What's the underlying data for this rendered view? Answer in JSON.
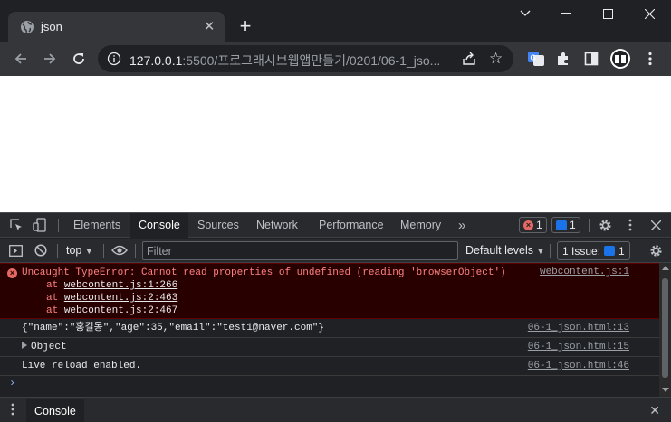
{
  "browser": {
    "tab_title": "json",
    "new_tab": "+",
    "url_host": "127.0.0.1",
    "url_rest": ":5500/프로그래시브웹앱만들기/0201/06-1_jso..."
  },
  "devtools": {
    "tabs": [
      {
        "label": "Elements"
      },
      {
        "label": "Console"
      },
      {
        "label": "Sources"
      },
      {
        "label": "Network"
      },
      {
        "label": "Performance"
      },
      {
        "label": "Memory"
      }
    ],
    "more_tabs": "»",
    "error_count": "1",
    "message_count": "1",
    "context": "top",
    "filter_placeholder": "Filter",
    "levels_label": "Default levels",
    "issues_label": "1 Issue:",
    "issues_count": "1"
  },
  "console": {
    "error": {
      "text": "Uncaught TypeError: Cannot read properties of undefined (reading 'browserObject')",
      "source": "webcontent.js:1",
      "stack": [
        {
          "prefix": "at ",
          "link": "webcontent.js:1:266"
        },
        {
          "prefix": "at ",
          "link": "webcontent.js:2:463"
        },
        {
          "prefix": "at ",
          "link": "webcontent.js:2:467"
        }
      ]
    },
    "logs": [
      {
        "text": "{\"name\":\"홍길동\",\"age\":35,\"email\":\"test1@naver.com\"}",
        "source": "06-1_json.html:13"
      },
      {
        "text": "Object",
        "source": "06-1_json.html:15"
      },
      {
        "text": "Live reload enabled.",
        "source": "06-1_json.html:46"
      }
    ],
    "prompt": "›"
  },
  "drawer": {
    "tab_label": "Console",
    "close": "✕"
  },
  "colors": {
    "chrome_dark": "#202124",
    "toolbar": "#35363a",
    "error_bg": "#290000",
    "error_text": "#ff8080",
    "accent_blue": "#1a73e8"
  }
}
